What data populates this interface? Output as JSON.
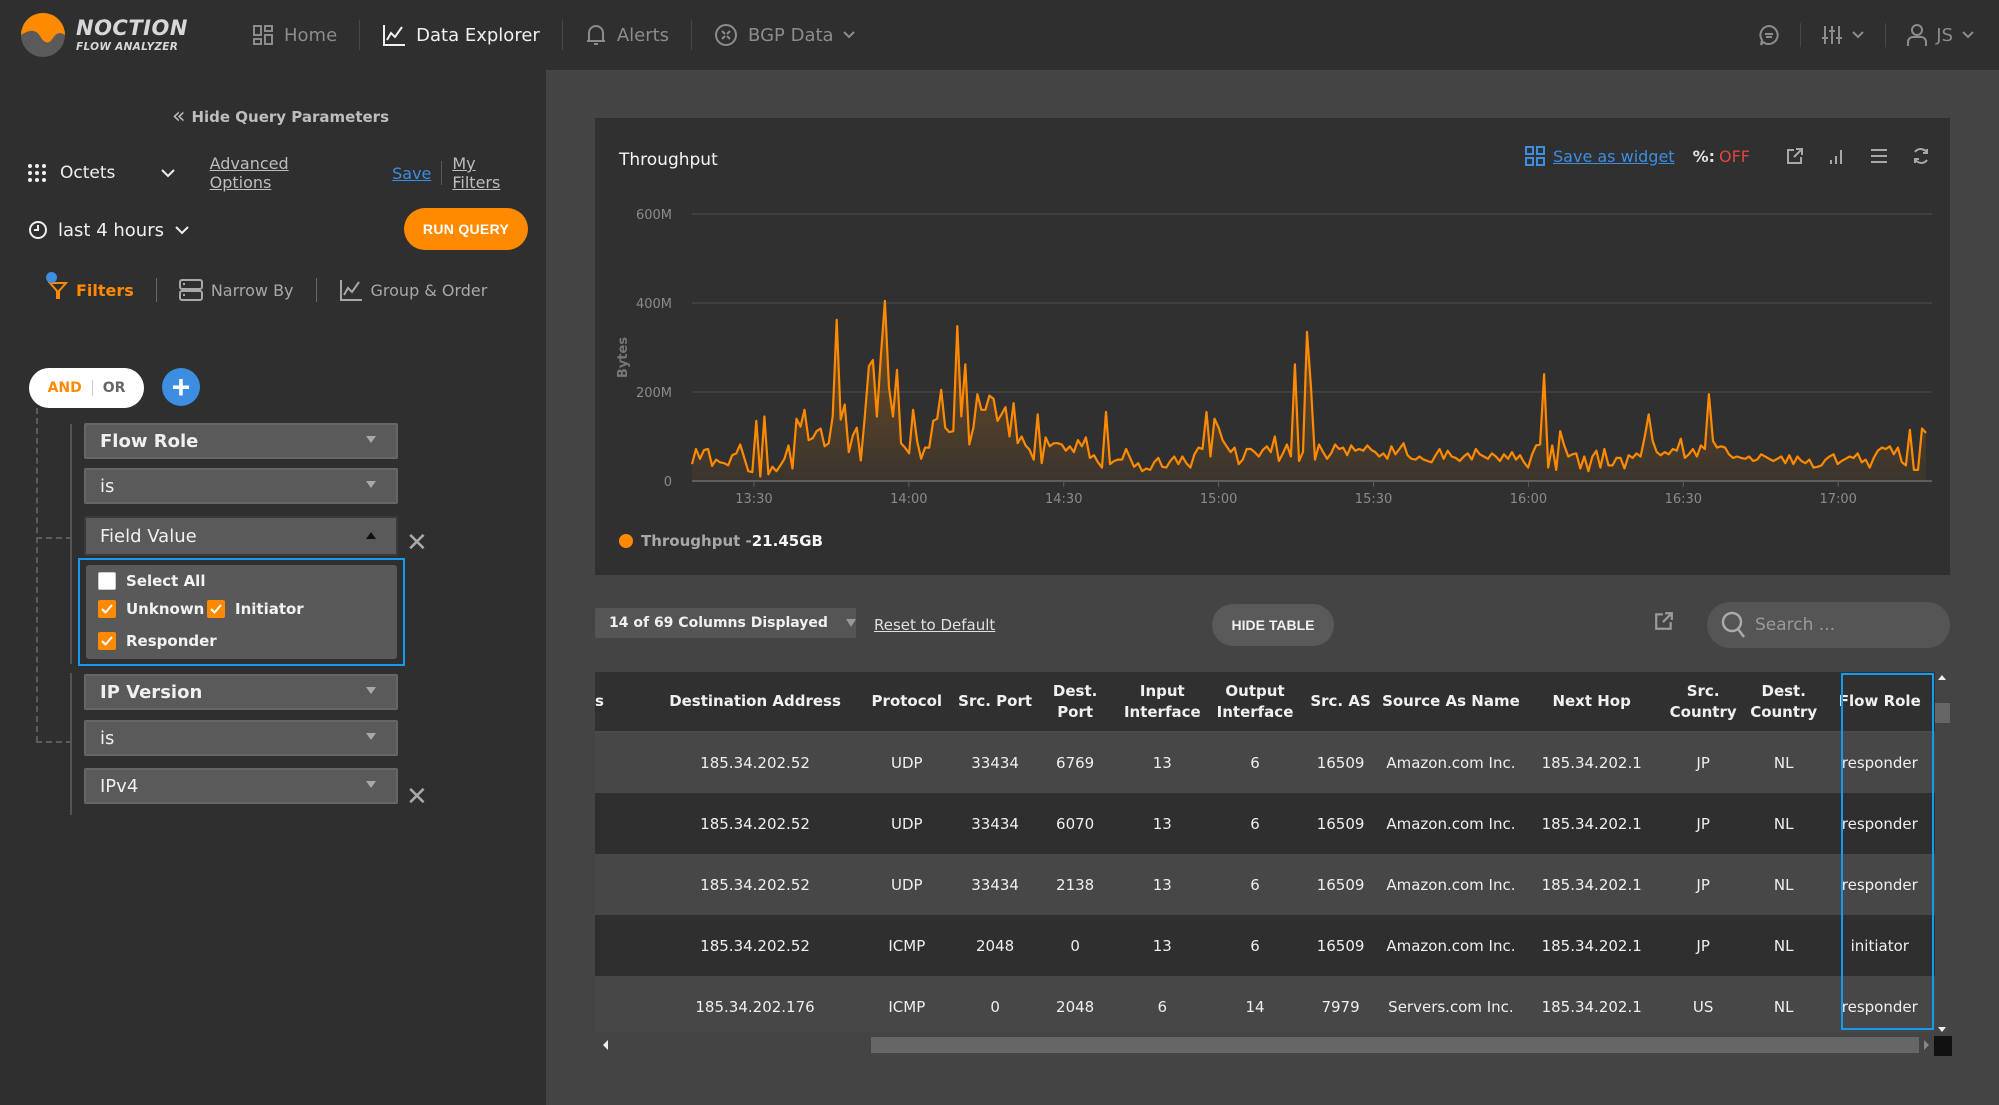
{
  "app": {
    "brand_line1": "NOCTION",
    "brand_line2": "FLOW ANALYZER",
    "accent": "#ff8a00",
    "link_blue": "#3d8ee0",
    "highlight_blue": "#129cf0"
  },
  "nav": {
    "items": [
      {
        "label": "Home",
        "icon": "home-grid-icon",
        "active": false
      },
      {
        "label": "Data Explorer",
        "icon": "line-chart-icon",
        "active": true
      },
      {
        "label": "Alerts",
        "icon": "bell-icon",
        "active": false
      },
      {
        "label": "BGP Data",
        "icon": "bgp-icon",
        "active": false,
        "has_dropdown": true
      }
    ],
    "right": {
      "chat_icon": "chat-bubble-icon",
      "settings_icon": "sliders-icon",
      "user_initials": "JS"
    }
  },
  "query": {
    "hide_label": "Hide Query Parameters",
    "metric": "Octets",
    "advanced_options": "Advanced Options",
    "save": "Save",
    "my_filters": "My Filters",
    "time_range": "last 4 hours",
    "run_query": "RUN QUERY",
    "tabs": [
      {
        "label": "Filters",
        "active": true
      },
      {
        "label": "Narrow By",
        "active": false
      },
      {
        "label": "Group & Order",
        "active": false
      }
    ],
    "logic": {
      "and": "AND",
      "or": "OR",
      "selected": "AND"
    },
    "filters": [
      {
        "field": "Flow Role",
        "operator": "is",
        "value_placeholder": "Field Value",
        "dropdown_open": true,
        "options": [
          {
            "label": "Select All",
            "checked": false
          },
          {
            "label": "Unknown",
            "checked": true
          },
          {
            "label": "Initiator",
            "checked": true
          },
          {
            "label": "Responder",
            "checked": true
          }
        ]
      },
      {
        "field": "IP Version",
        "operator": "is",
        "value": "IPv4"
      }
    ]
  },
  "chart_panel": {
    "save_as_widget": "Save as widget",
    "percent_label": "%:",
    "percent_state": "OFF",
    "legend_label": "Throughput - ",
    "legend_total": "21.45GB"
  },
  "chart_data": {
    "type": "area",
    "title": "Throughput",
    "xlabel": "",
    "ylabel": "Bytes",
    "ylim": [
      0,
      600
    ],
    "y_unit": "M",
    "yticks": [
      "0",
      "200M",
      "400M",
      "600M"
    ],
    "ytick_values": [
      0,
      200,
      400,
      600
    ],
    "xlim_minutes": [
      798,
      1037
    ],
    "xticks": [
      "13:30",
      "14:00",
      "14:30",
      "15:00",
      "15:30",
      "16:00",
      "16:30",
      "17:00"
    ],
    "xtick_minutes": [
      810,
      840,
      870,
      900,
      930,
      960,
      990,
      1020
    ],
    "grid": true,
    "legend": "bottom-left",
    "series": [
      {
        "name": "Throughput",
        "color": "#ff8a00",
        "start_minute": 798,
        "step_minutes": 1.25,
        "values": [
          38,
          72,
          50,
          70,
          72,
          34,
          48,
          42,
          40,
          35,
          58,
          62,
          82,
          52,
          22,
          20,
          135,
          10,
          145,
          15,
          32,
          22,
          35,
          50,
          80,
          28,
          140,
          122,
          160,
          92,
          96,
          112,
          118,
          78,
          85,
          145,
          362,
          138,
          172,
          65,
          102,
          120,
          46,
          145,
          258,
          272,
          145,
          282,
          405,
          210,
          145,
          250,
          85,
          75,
          62,
          160,
          90,
          50,
          75,
          75,
          135,
          140,
          205,
          120,
          110,
          112,
          348,
          145,
          262,
          82,
          120,
          195,
          160,
          160,
          192,
          185,
          135,
          150,
          166,
          100,
          175,
          85,
          100,
          80,
          70,
          48,
          150,
          40,
          98,
          78,
          85,
          85,
          82,
          68,
          78,
          65,
          92,
          78,
          98,
          52,
          58,
          42,
          30,
          155,
          38,
          45,
          48,
          48,
          72,
          52,
          32,
          40,
          22,
          28,
          25,
          42,
          52,
          32,
          30,
          45,
          55,
          38,
          55,
          40,
          30,
          60,
          75,
          72,
          155,
          55,
          140,
          120,
          92,
          78,
          65,
          75,
          38,
          48,
          72,
          72,
          65,
          55,
          70,
          78,
          65,
          100,
          45,
          62,
          82,
          55,
          262,
          45,
          65,
          335,
          210,
          48,
          82,
          65,
          50,
          62,
          82,
          72,
          75,
          58,
          80,
          68,
          72,
          68,
          80,
          70,
          65,
          55,
          62,
          50,
          78,
          60,
          72,
          85,
          58,
          50,
          48,
          55,
          48,
          45,
          42,
          58,
          72,
          50,
          68,
          55,
          52,
          45,
          55,
          62,
          48,
          72,
          60,
          55,
          50,
          62,
          55,
          45,
          60,
          50,
          65,
          48,
          58,
          42,
          30,
          60,
          80,
          82,
          240,
          30,
          80,
          25,
          112,
          80,
          55,
          60,
          62,
          28,
          55,
          22,
          55,
          68,
          30,
          72,
          35,
          35,
          52,
          52,
          28,
          58,
          52,
          62,
          55,
          98,
          150,
          90,
          65,
          58,
          65,
          60,
          72,
          68,
          95,
          52,
          60,
          72,
          55,
          80,
          72,
          195,
          90,
          75,
          78,
          75,
          60,
          52,
          55,
          52,
          50,
          55,
          45,
          48,
          60,
          55,
          50,
          45,
          50,
          55,
          40,
          58,
          38,
          55,
          45,
          40,
          48,
          30,
          32,
          35,
          48,
          55,
          60,
          38,
          45,
          50,
          55,
          52,
          62,
          42,
          48,
          30,
          52,
          68,
          75,
          72,
          78,
          60,
          75,
          42,
          35,
          115,
          25,
          25,
          118,
          108
        ]
      }
    ]
  },
  "table_toolbar": {
    "columns_displayed": "14 of 69 Columns Displayed",
    "reset": "Reset to Default",
    "hide_table": "HIDE TABLE",
    "search_placeholder": "Search ..."
  },
  "table": {
    "columns": [
      {
        "key": "src",
        "label": "s"
      },
      {
        "key": "dst",
        "label": "Destination Address"
      },
      {
        "key": "proto",
        "label": "Protocol"
      },
      {
        "key": "sport",
        "label": "Src. Port"
      },
      {
        "key": "dport",
        "label": "Dest. Port"
      },
      {
        "key": "inif",
        "label": "Input Interface"
      },
      {
        "key": "outif",
        "label": "Output Interface"
      },
      {
        "key": "srcas",
        "label": "Src. AS"
      },
      {
        "key": "asname",
        "label": "Source As Name"
      },
      {
        "key": "nexthop",
        "label": "Next Hop"
      },
      {
        "key": "srccc",
        "label": "Src. Country"
      },
      {
        "key": "dstcc",
        "label": "Dest. Country"
      },
      {
        "key": "role",
        "label": "Flow Role"
      }
    ],
    "rows": [
      [
        "",
        "185.34.202.52",
        "UDP",
        "33434",
        "6769",
        "13",
        "6",
        "16509",
        "Amazon.com Inc.",
        "185.34.202.1",
        "JP",
        "NL",
        "responder"
      ],
      [
        "",
        "185.34.202.52",
        "UDP",
        "33434",
        "6070",
        "13",
        "6",
        "16509",
        "Amazon.com Inc.",
        "185.34.202.1",
        "JP",
        "NL",
        "responder"
      ],
      [
        "",
        "185.34.202.52",
        "UDP",
        "33434",
        "2138",
        "13",
        "6",
        "16509",
        "Amazon.com Inc.",
        "185.34.202.1",
        "JP",
        "NL",
        "responder"
      ],
      [
        "",
        "185.34.202.52",
        "ICMP",
        "2048",
        "0",
        "13",
        "6",
        "16509",
        "Amazon.com Inc.",
        "185.34.202.1",
        "JP",
        "NL",
        "initiator"
      ],
      [
        "",
        "185.34.202.176",
        "ICMP",
        "0",
        "2048",
        "6",
        "14",
        "7979",
        "Servers.com Inc.",
        "185.34.202.1",
        "US",
        "NL",
        "responder"
      ]
    ]
  }
}
